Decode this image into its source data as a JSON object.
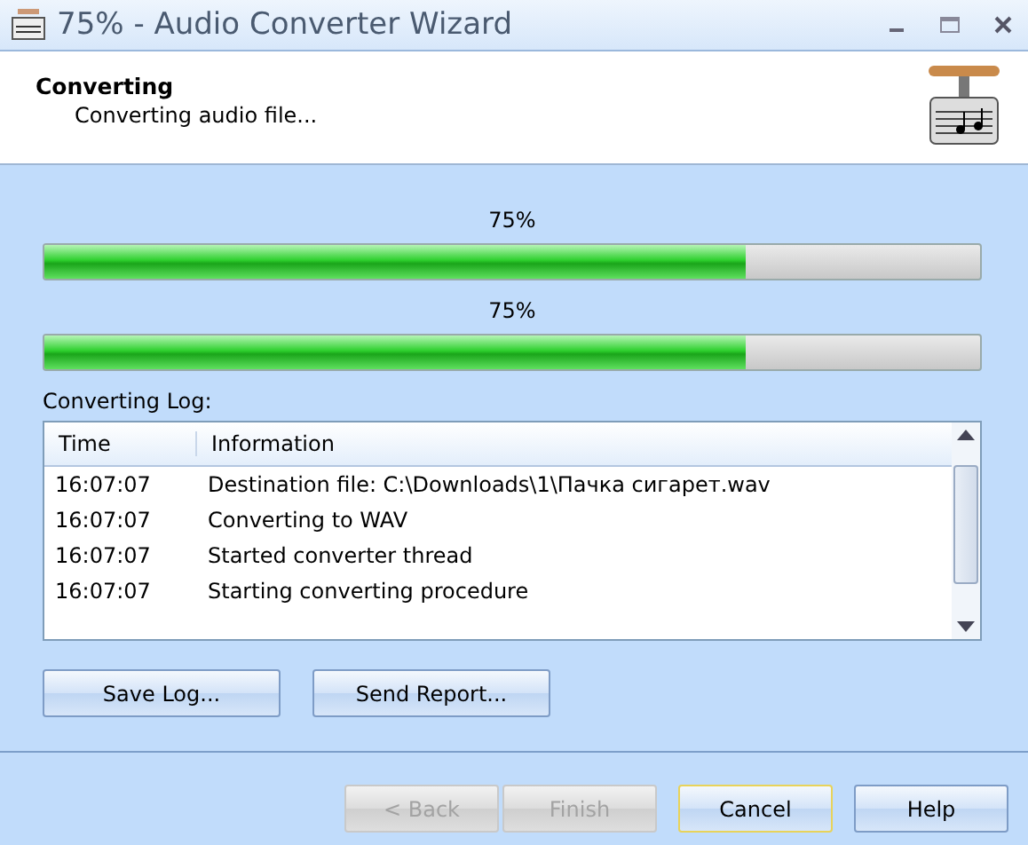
{
  "window": {
    "title": "75% - Audio Converter Wizard"
  },
  "header": {
    "title": "Converting",
    "subtitle": "Converting audio file..."
  },
  "progress": [
    {
      "reading": "75%",
      "level": 0.75
    },
    {
      "reading": "75%",
      "level": 0.75
    }
  ],
  "log": {
    "label": "Converting Log:",
    "columns": [
      "Time",
      "Information"
    ],
    "rows": [
      {
        "time": "16:07:07",
        "info": "Destination file: C:\\Downloads\\1\\Пачка сигарет.wav"
      },
      {
        "time": "16:07:07",
        "info": "Converting to WAV"
      },
      {
        "time": "16:07:07",
        "info": "Started converter thread"
      },
      {
        "time": "16:07:07",
        "info": "Starting converting procedure"
      }
    ]
  },
  "log_buttons": [
    "Save Log...",
    "Send Report..."
  ],
  "nav_buttons": [
    {
      "label": "< Back",
      "disabled": true,
      "default": false
    },
    {
      "label": "Finish",
      "disabled": true,
      "default": false
    },
    {
      "label": "Cancel",
      "disabled": false,
      "default": true
    },
    {
      "label": "Help",
      "disabled": false,
      "default": false
    }
  ]
}
